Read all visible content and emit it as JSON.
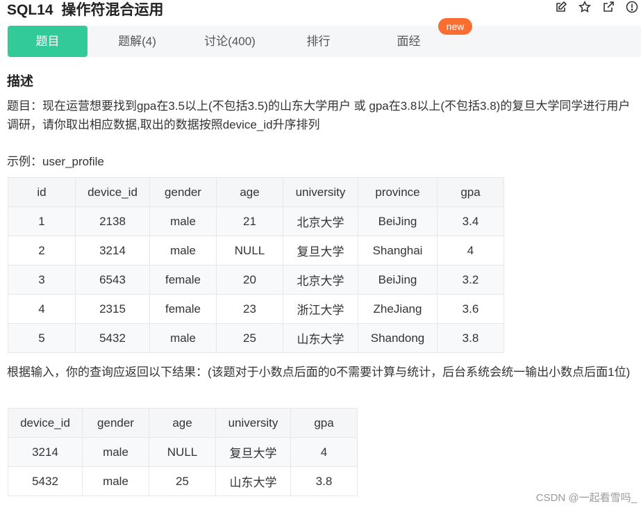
{
  "header": {
    "problem_id": "SQL14",
    "problem_name": "操作符混合运用",
    "icons": [
      "edit-icon",
      "star-icon",
      "external-link-icon",
      "info-icon"
    ]
  },
  "tabs": [
    {
      "label": "题目",
      "active": true
    },
    {
      "label": "题解(4)",
      "active": false
    },
    {
      "label": "讨论(400)",
      "active": false
    },
    {
      "label": "排行",
      "active": false
    },
    {
      "label": "面经",
      "active": false
    }
  ],
  "new_badge": "new",
  "section_title": "描述",
  "description": "题目：现在运营想要找到gpa在3.5以上(不包括3.5)的山东大学用户 或 gpa在3.8以上(不包括3.8)的复旦大学同学进行用户调研，请你取出相应数据,取出的数据按照device_id升序排列",
  "example_label": "示例：user_profile",
  "table1": {
    "columns": [
      "id",
      "device_id",
      "gender",
      "age",
      "university",
      "province",
      "gpa"
    ],
    "rows": [
      [
        "1",
        "2138",
        "male",
        "21",
        "北京大学",
        "BeiJing",
        "3.4"
      ],
      [
        "2",
        "3214",
        "male",
        "NULL",
        "复旦大学",
        "Shanghai",
        "4"
      ],
      [
        "3",
        "6543",
        "female",
        "20",
        "北京大学",
        "BeiJing",
        "3.2"
      ],
      [
        "4",
        "2315",
        "female",
        "23",
        "浙江大学",
        "ZheJiang",
        "3.6"
      ],
      [
        "5",
        "5432",
        "male",
        "25",
        "山东大学",
        "Shandong",
        "3.8"
      ]
    ]
  },
  "result_text": "根据输入，你的查询应返回以下结果：(该题对于小数点后面的0不需要计算与统计，后台系统会统一输出小数点后面1位)",
  "table2": {
    "columns": [
      "device_id",
      "gender",
      "age",
      "university",
      "gpa"
    ],
    "rows": [
      [
        "3214",
        "male",
        "NULL",
        "复旦大学",
        "4"
      ],
      [
        "5432",
        "male",
        "25",
        "山东大学",
        "3.8"
      ]
    ]
  },
  "watermark": "CSDN @一起看雪吗_",
  "colors": {
    "accent": "#32ca99",
    "badge": "#fa6e32"
  }
}
